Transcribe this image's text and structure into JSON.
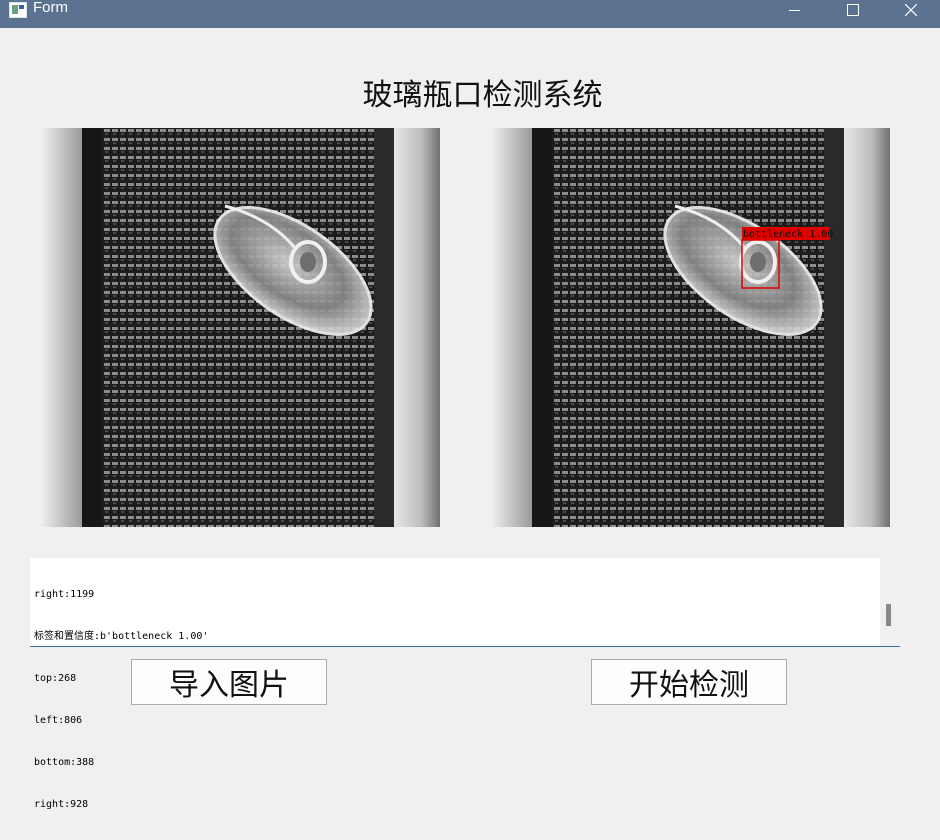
{
  "window": {
    "title": "Form",
    "minimize_icon": "minimize-icon",
    "maximize_icon": "maximize-icon",
    "close_icon": "close-icon"
  },
  "header": {
    "title": "玻璃瓶口检测系统"
  },
  "detection": {
    "box_label": "bottleneck 1.00",
    "box_color": "#e00000"
  },
  "log": {
    "lines": [
      "right:1199",
      "标签和置信度:b'bottleneck 1.00'",
      "top:268",
      "left:806",
      "bottom:388",
      "right:928"
    ]
  },
  "buttons": {
    "import_label": "导入图片",
    "detect_label": "开始检测"
  }
}
